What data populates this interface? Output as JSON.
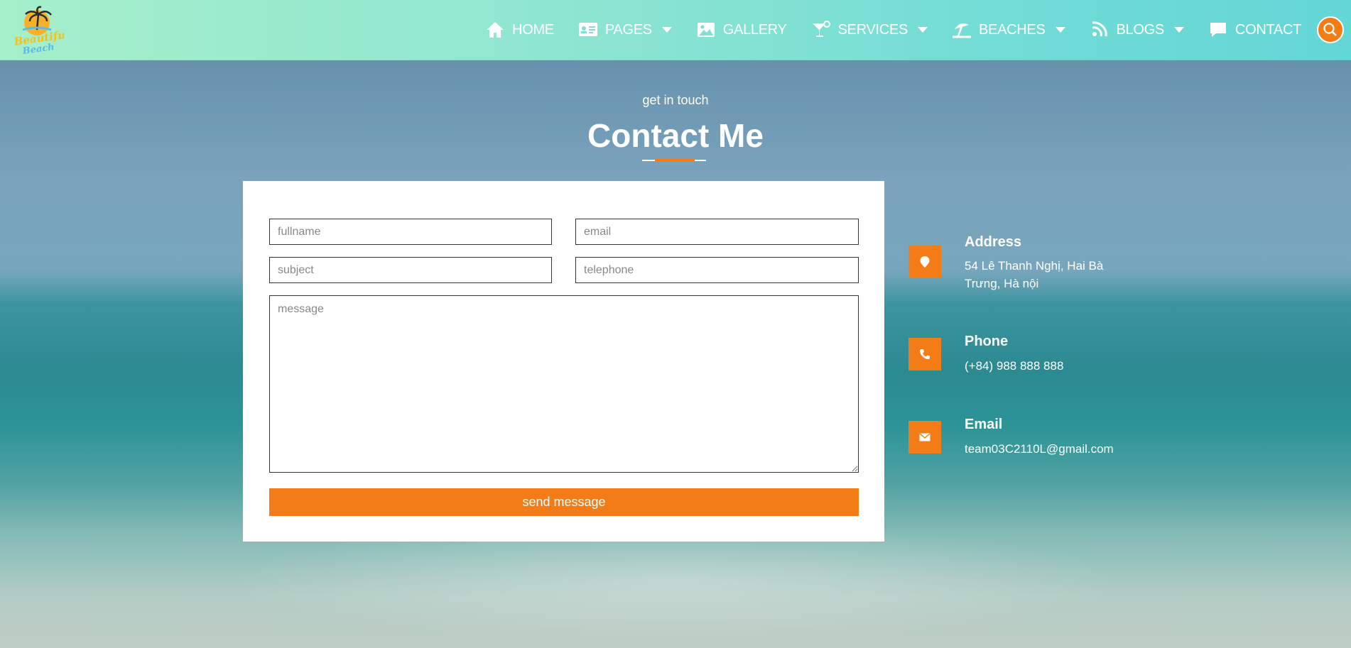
{
  "nav": {
    "logo_text": "Beautiful Beach",
    "items": [
      {
        "label": "HOME",
        "icon": "home-icon",
        "has_dropdown": false
      },
      {
        "label": "PAGES",
        "icon": "id-card-icon",
        "has_dropdown": true
      },
      {
        "label": "GALLERY",
        "icon": "image-icon",
        "has_dropdown": false
      },
      {
        "label": "SERVICES",
        "icon": "cocktail-icon",
        "has_dropdown": true
      },
      {
        "label": "BEACHES",
        "icon": "umbrella-beach-icon",
        "has_dropdown": true
      },
      {
        "label": "BLOGS",
        "icon": "rss-icon",
        "has_dropdown": true
      },
      {
        "label": "CONTACT",
        "icon": "comment-icon",
        "has_dropdown": false
      }
    ],
    "search_icon": "search-icon"
  },
  "header": {
    "subtitle": "get in touch",
    "title": "Contact Me"
  },
  "form": {
    "fullname_placeholder": "fullname",
    "email_placeholder": "email",
    "subject_placeholder": "subject",
    "telephone_placeholder": "telephone",
    "message_placeholder": "message",
    "submit_label": "send message"
  },
  "contact_info": {
    "address": {
      "label": "Address",
      "line1": "54 Lê Thanh Nghị, Hai Bà",
      "line2": "Trưng, Hà nội",
      "icon": "map-marker-icon"
    },
    "phone": {
      "label": "Phone",
      "value": "(+84) 988 888 888",
      "icon": "phone-icon"
    },
    "email": {
      "label": "Email",
      "value": "team03C2110L@gmail.com",
      "icon": "envelope-icon"
    }
  },
  "colors": {
    "accent": "#f47c17",
    "nav_gradient_start": "#a6efcb",
    "nav_gradient_end": "#63d6d6"
  }
}
